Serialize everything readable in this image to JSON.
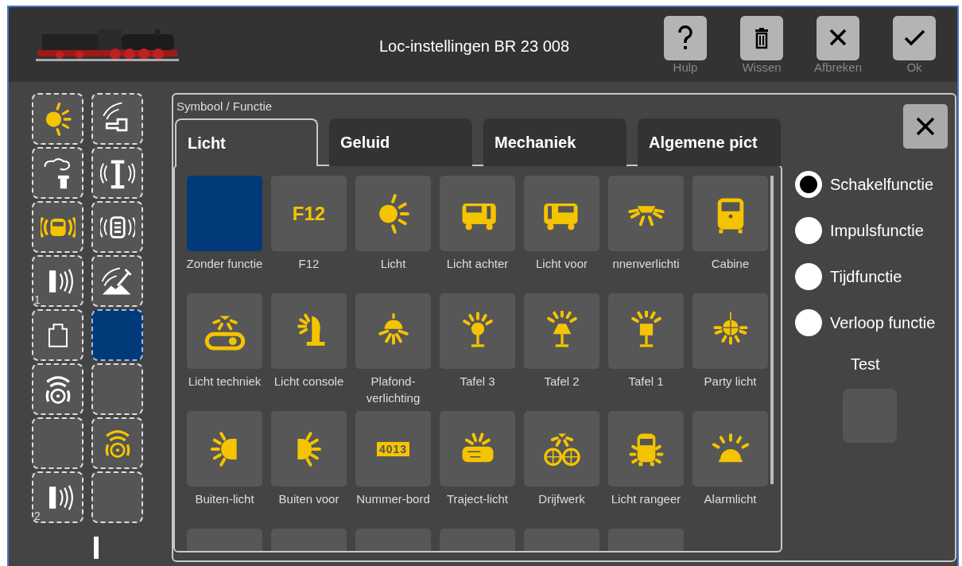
{
  "header": {
    "title": "Loc-instellingen BR 23 008",
    "buttons": [
      {
        "kind": "help",
        "label": "Hulp"
      },
      {
        "kind": "delete",
        "label": "Wissen"
      },
      {
        "kind": "cancel",
        "label": "Afbreken"
      },
      {
        "kind": "ok",
        "label": "Ok"
      }
    ]
  },
  "slots": [
    {
      "kind": "sun",
      "active": true,
      "selected": false
    },
    {
      "kind": "coupling",
      "active": false,
      "selected": false
    },
    {
      "kind": "smoke",
      "active": false,
      "selected": false
    },
    {
      "kind": "pump",
      "active": false,
      "selected": false
    },
    {
      "kind": "sound-loco",
      "active": true,
      "selected": false
    },
    {
      "kind": "sound-box",
      "active": false,
      "selected": false
    },
    {
      "kind": "door-sound",
      "active": false,
      "selected": false,
      "number": "1"
    },
    {
      "kind": "shovel",
      "active": false,
      "selected": false
    },
    {
      "kind": "weight",
      "active": false,
      "selected": false
    },
    {
      "kind": "empty",
      "selected": true
    },
    {
      "kind": "wheel-sound",
      "active": false,
      "selected": false
    },
    {
      "kind": "empty",
      "selected": false
    },
    {
      "kind": "empty",
      "selected": false
    },
    {
      "kind": "wheel-sound",
      "active": true,
      "selected": false
    },
    {
      "kind": "door-sound",
      "active": false,
      "selected": false,
      "number": "2"
    },
    {
      "kind": "empty",
      "selected": false
    }
  ],
  "panel": {
    "title": "Symbool / Functie",
    "tabs": [
      {
        "label": "Licht",
        "selected": true
      },
      {
        "label": "Geluid",
        "selected": false
      },
      {
        "label": "Mechaniek",
        "selected": false
      },
      {
        "label": "Algemene pict",
        "selected": false
      }
    ],
    "symbols": [
      {
        "kind": "empty",
        "label": "Zonder functie",
        "selected": true
      },
      {
        "kind": "text",
        "icon_text": "F12",
        "label": "F12",
        "selected": false
      },
      {
        "kind": "sun",
        "label": "Licht",
        "selected": false
      },
      {
        "kind": "railcar",
        "label": "Licht achter",
        "selected": false
      },
      {
        "kind": "railcar-front",
        "label": "Licht voor",
        "selected": false
      },
      {
        "kind": "ceiling-lamp",
        "label": "nnenverlichti",
        "selected": false
      },
      {
        "kind": "cabin",
        "label": "Cabine",
        "selected": false
      },
      {
        "kind": "conveyor",
        "label": "Licht techniek",
        "selected": false
      },
      {
        "kind": "desk-lamp",
        "label": "Licht console",
        "selected": false
      },
      {
        "kind": "pendant-lamp",
        "label": "Plafond-verlichting",
        "selected": false
      },
      {
        "kind": "lamp-round",
        "label": "Tafel 3",
        "selected": false
      },
      {
        "kind": "lamp-cone",
        "label": "Tafel 2",
        "selected": false
      },
      {
        "kind": "lamp-square",
        "label": "Tafel 1",
        "selected": false
      },
      {
        "kind": "disco-ball",
        "label": "Party licht",
        "selected": false
      },
      {
        "kind": "beam-left",
        "label": "Buiten-licht",
        "selected": false
      },
      {
        "kind": "beam-right",
        "label": "Buiten voor",
        "selected": false
      },
      {
        "kind": "number-plate",
        "icon_text": "4013",
        "label": "Nummer-bord",
        "selected": false
      },
      {
        "kind": "panel-light",
        "label": "Traject-licht",
        "selected": false
      },
      {
        "kind": "wheels",
        "label": "Drijfwerk",
        "selected": false
      },
      {
        "kind": "loco-front",
        "label": "Licht rangeer",
        "selected": false
      },
      {
        "kind": "alarm",
        "label": "Alarmlicht",
        "selected": false
      },
      {
        "kind": "empty",
        "selected": false
      },
      {
        "kind": "empty",
        "selected": false
      },
      {
        "kind": "empty",
        "selected": false
      },
      {
        "kind": "empty",
        "selected": false
      },
      {
        "kind": "empty",
        "selected": false
      },
      {
        "kind": "empty",
        "selected": false
      }
    ],
    "modes": [
      {
        "label": "Schakelfunctie",
        "selected": true
      },
      {
        "label": "Impulsfunctie",
        "selected": false
      },
      {
        "label": "Tijdfunctie",
        "selected": false
      },
      {
        "label": "Verloop functie",
        "selected": false
      }
    ],
    "test_label": "Test"
  }
}
